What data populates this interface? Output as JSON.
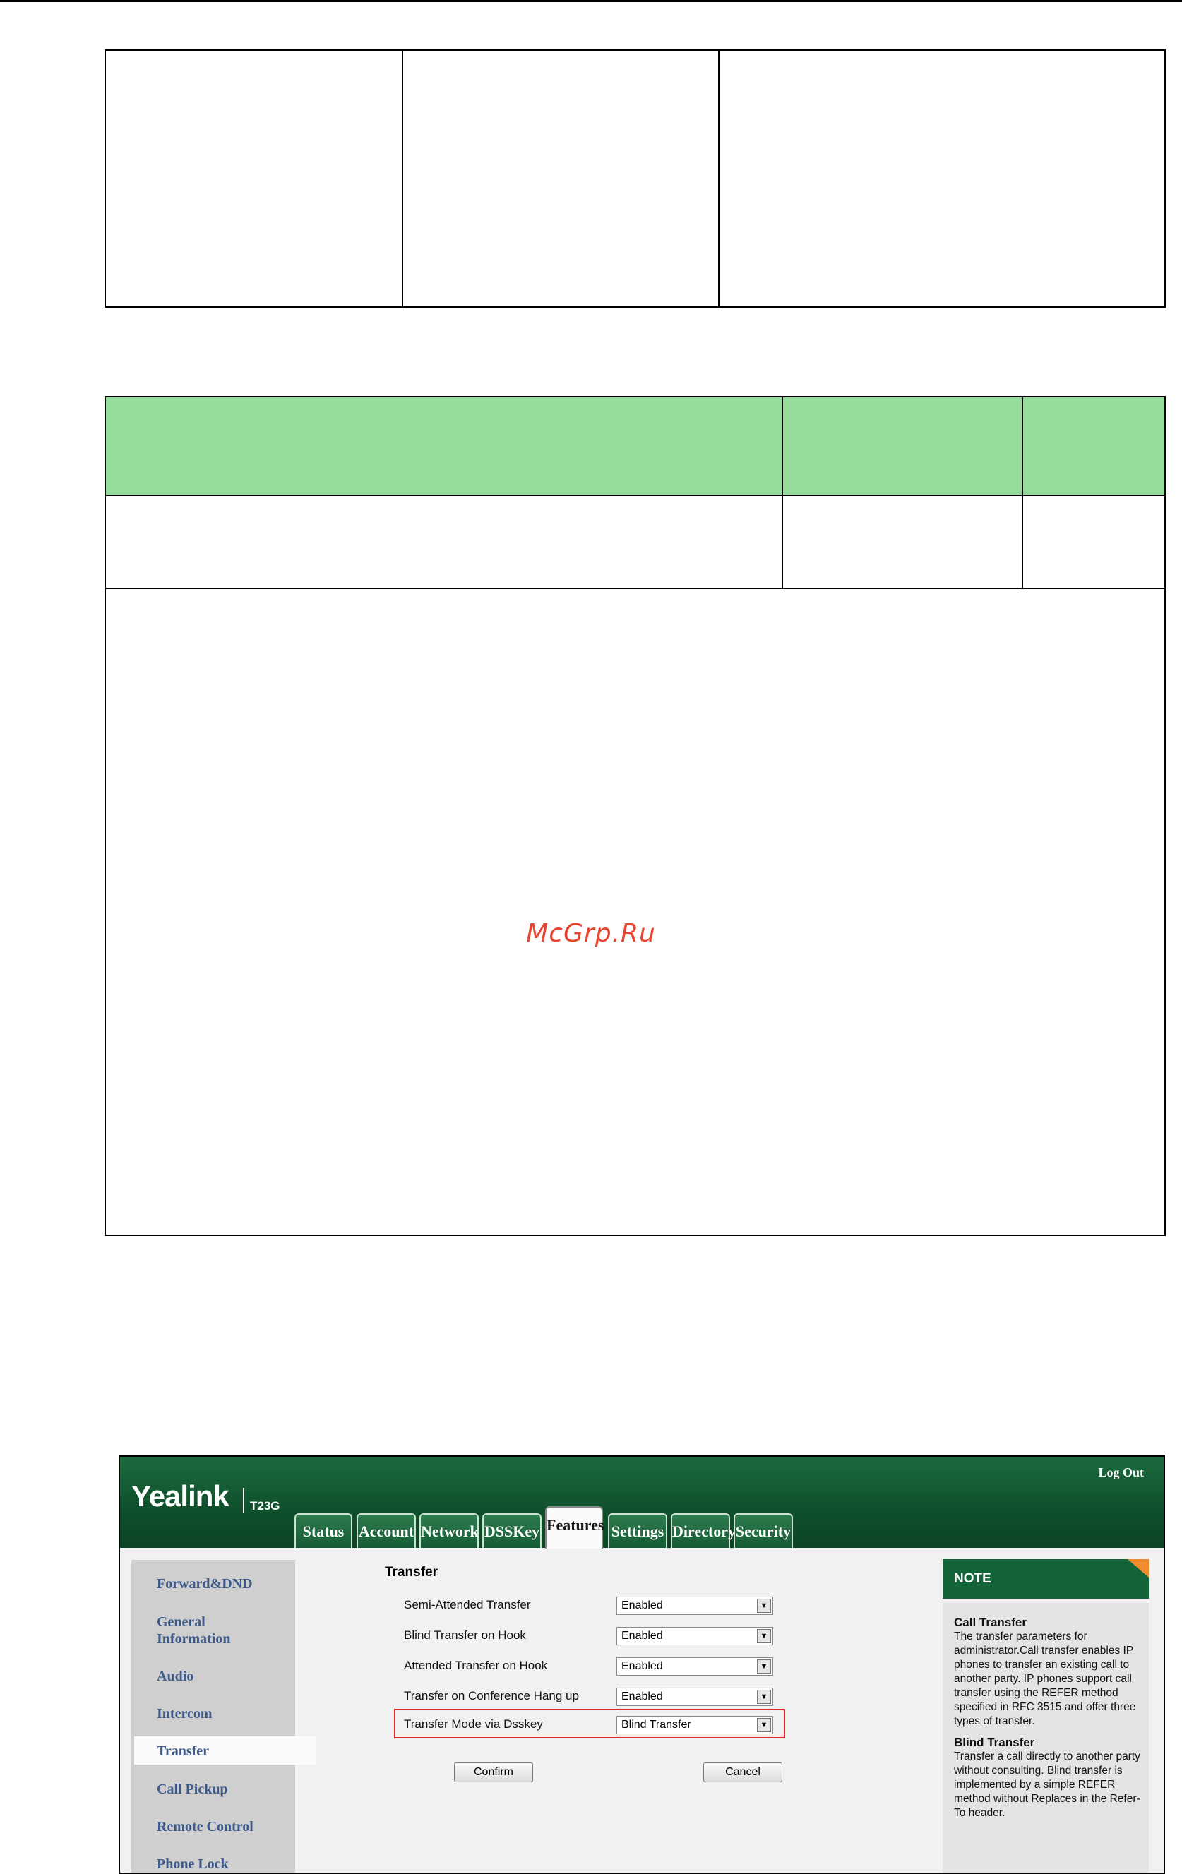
{
  "watermark": "McGrp.Ru",
  "ui": {
    "brand": "Yealink",
    "model": "T23G",
    "logout": "Log Out",
    "tabs": [
      "Status",
      "Account",
      "Network",
      "DSSKey",
      "Features",
      "Settings",
      "Directory",
      "Security"
    ],
    "active_tab": "Features",
    "sidebar": [
      "Forward&DND",
      "General Information",
      "Audio",
      "Intercom",
      "Transfer",
      "Call Pickup",
      "Remote Control",
      "Phone Lock"
    ],
    "active_sidebar": "Transfer",
    "section_title": "Transfer",
    "fields": [
      {
        "label": "Semi-Attended Transfer",
        "value": "Enabled"
      },
      {
        "label": "Blind Transfer on Hook",
        "value": "Enabled"
      },
      {
        "label": "Attended Transfer on Hook",
        "value": "Enabled"
      },
      {
        "label": "Transfer on Conference Hang up",
        "value": "Enabled"
      },
      {
        "label": "Transfer Mode via Dsskey",
        "value": "Blind Transfer"
      }
    ],
    "confirm": "Confirm",
    "cancel": "Cancel",
    "note": {
      "title": "NOTE",
      "sections": [
        {
          "heading": "Call Transfer",
          "text": "The transfer parameters for administrator.Call transfer enables IP phones to transfer an existing call to another party. IP phones support call transfer using the REFER method specified in RFC 3515 and offer three types of transfer."
        },
        {
          "heading": "Blind Transfer",
          "text": "Transfer a call directly to another party without consulting. Blind transfer is implemented by a simple REFER method without Replaces in the Refer-To header."
        }
      ]
    }
  }
}
